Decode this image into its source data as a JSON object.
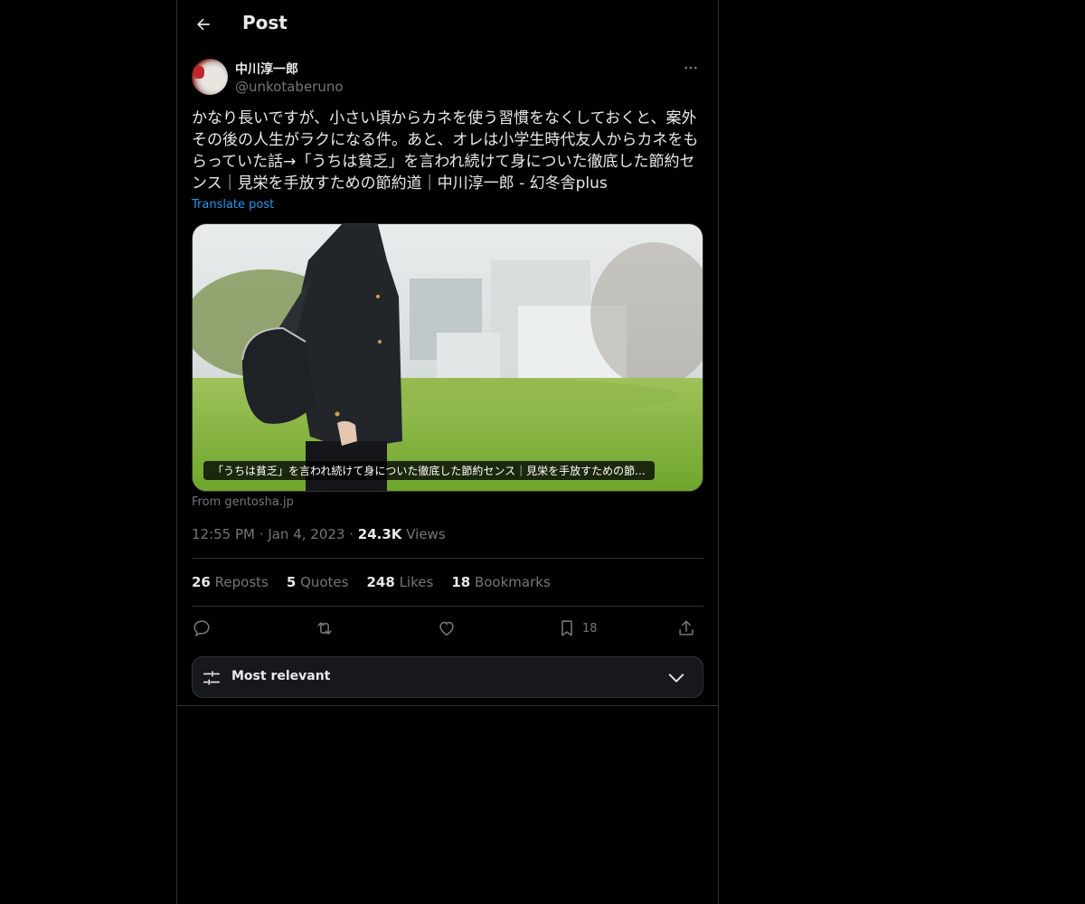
{
  "header": {
    "title": "Post"
  },
  "author": {
    "display_name": "中川淳一郎",
    "handle": "@unkotaberuno"
  },
  "post": {
    "text": "かなり長いですが、小さい頃からカネを使う習慣をなくしておくと、案外その後の人生がラクになる件。あと、オレは小学生時代友人からカネをもらっていた話→「うちは貧乏」を言われ続けて身についた徹底した節約センス｜見栄を手放すための節約道｜中川淳一郎 - 幻冬舎plus",
    "translate_label": "Translate post"
  },
  "card": {
    "caption": "「うちは貧乏」を言われ続けて身についた徹底した節約センス｜見栄を手放すための節...",
    "source": "From gentosha.jp"
  },
  "meta": {
    "time": "12:55 PM",
    "date": "Jan 4, 2023",
    "views_count": "24.3K",
    "views_label": "Views"
  },
  "stats": {
    "reposts_count": "26",
    "reposts_label": "Reposts",
    "quotes_count": "5",
    "quotes_label": "Quotes",
    "likes_count": "248",
    "likes_label": "Likes",
    "bookmarks_count": "18",
    "bookmarks_label": "Bookmarks"
  },
  "actions": {
    "bookmark_count": "18"
  },
  "sort": {
    "label": "Most relevant"
  },
  "colors": {
    "background": "#000000",
    "accent": "#1d9bf0",
    "muted": "#71767b",
    "border": "#2f3336"
  }
}
